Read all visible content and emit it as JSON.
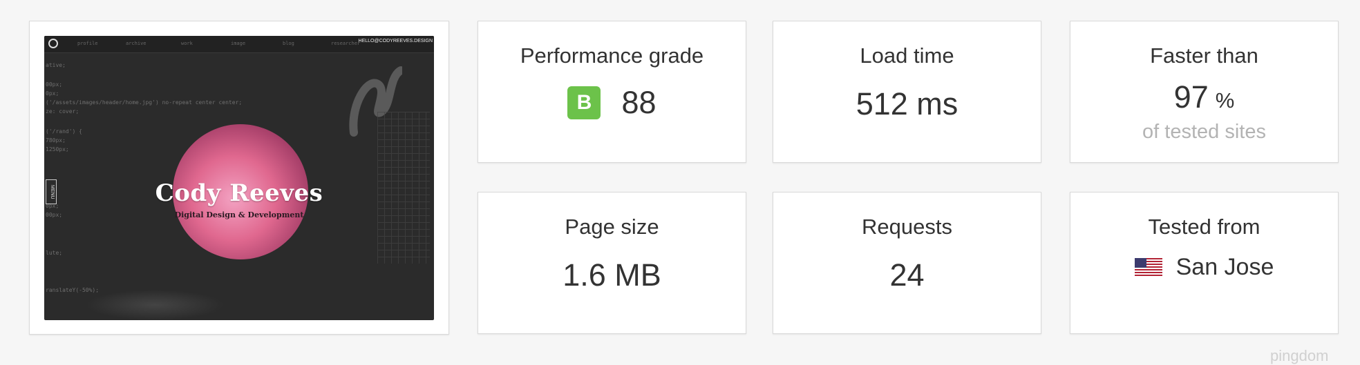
{
  "screenshot": {
    "browser_tabs": [
      "profile",
      "archive",
      "work",
      "image",
      "blog",
      "researcher"
    ],
    "email": "HELLO@CODYREEVES.DESIGN",
    "menu_label": "MENU",
    "hero_name": "Cody Reeves",
    "hero_tagline": "Digital Design & Development",
    "code_lines": [
      "ative;",
      "00px;",
      "0px;",
      "('/assets/images/header/home.jpg') no-repeat center center;",
      "ze: cover;",
      "('/rand') {",
      "780px;",
      "1250px;",
      "0px;",
      "00px;",
      "lute;",
      "ranslateY(-50%);"
    ]
  },
  "metrics": {
    "performance": {
      "label": "Performance grade",
      "grade": "B",
      "score": "88",
      "grade_color": "#6cc24a"
    },
    "load_time": {
      "label": "Load time",
      "value": "512 ms"
    },
    "faster_than": {
      "label": "Faster than",
      "value": "97",
      "unit": "%",
      "sub": "of tested sites"
    },
    "page_size": {
      "label": "Page size",
      "value": "1.6 MB"
    },
    "requests": {
      "label": "Requests",
      "value": "24"
    },
    "tested_from": {
      "label": "Tested from",
      "location": "San Jose",
      "flag": "us-flag-icon"
    }
  },
  "watermark": "pingdom"
}
